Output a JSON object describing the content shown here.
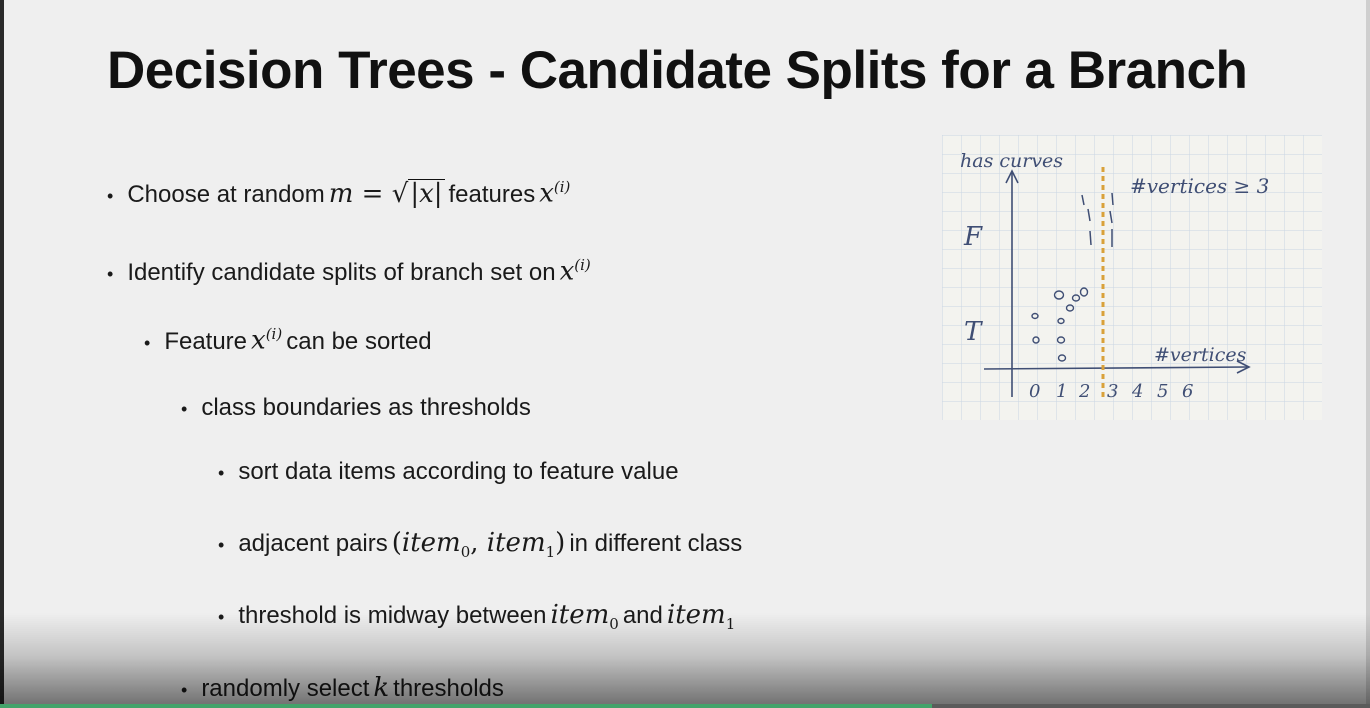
{
  "slide": {
    "title": "Decision Trees - Candidate Splits for a Branch",
    "b1": {
      "pre": "Choose at random",
      "m": "m",
      "eq": " = √",
      "absx": "|x|",
      "mid": "features",
      "x": "x",
      "sup": "(i)"
    },
    "b2": {
      "pre": "Identify candidate splits of branch set on",
      "x": "x",
      "sup": "(i)"
    },
    "b3": {
      "pre": "Feature",
      "x": "x",
      "sup": "(i)",
      "post": "can be sorted"
    },
    "b4": {
      "text": "class boundaries as thresholds"
    },
    "b5": {
      "text": "sort data items according to feature value"
    },
    "b6": {
      "pre": "adjacent pairs",
      "open": "(",
      "item": "item",
      "sub0": "0",
      "comma": ", ",
      "item1": "item",
      "sub1": "1",
      "close": ")",
      "post": "in different class"
    },
    "b7": {
      "pre": "threshold is midway between",
      "item": "item",
      "sub0": "0",
      "and": "and",
      "item1": "item",
      "sub1": "1"
    },
    "b8": {
      "pre": "randomly select",
      "k": "k",
      "post": "thresholds"
    }
  },
  "sketch": {
    "y_label": "has curves",
    "x_label": "#vertices",
    "threshold_label": "#vertices ≥ 3",
    "y_true": "T",
    "y_false": "F",
    "x_ticks": [
      "0",
      "1",
      "2",
      "3",
      "4",
      "5",
      "6"
    ],
    "ink_color": "#3f4e74",
    "threshold_color": "#d9a13a"
  },
  "video": {
    "progress": 0.68,
    "progress_color": "#43a36a"
  }
}
